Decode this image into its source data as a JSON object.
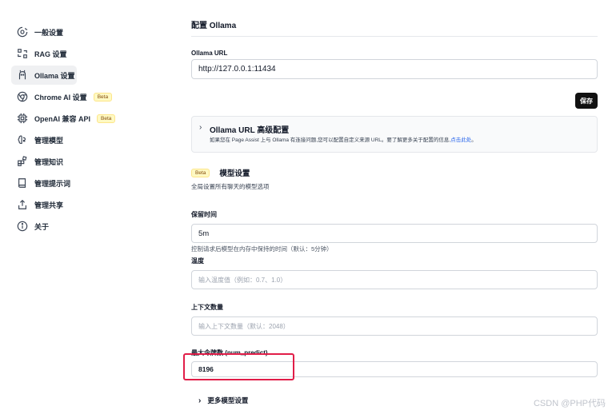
{
  "sidebar": {
    "items": [
      {
        "label": "一般设置",
        "icon": "gear-icon"
      },
      {
        "label": "RAG 设置",
        "icon": "rag-icon"
      },
      {
        "label": "Ollama 设置",
        "icon": "ollama-icon"
      },
      {
        "label": "Chrome AI 设置",
        "icon": "chrome-icon",
        "badge": "Beta"
      },
      {
        "label": "OpenAI 兼容 API",
        "icon": "chip-icon",
        "badge": "Beta"
      },
      {
        "label": "管理模型",
        "icon": "brain-icon"
      },
      {
        "label": "管理知识",
        "icon": "blocks-icon"
      },
      {
        "label": "管理提示词",
        "icon": "book-icon"
      },
      {
        "label": "管理共享",
        "icon": "share-icon"
      },
      {
        "label": "关于",
        "icon": "info-icon"
      }
    ]
  },
  "main": {
    "section_title": "配置 Ollama",
    "ollama_url_label": "Ollama URL",
    "ollama_url_value": "http://127.0.0.1:11434",
    "save_label": "保存",
    "advanced": {
      "title": "Ollama URL 高级配置",
      "description": "如果您在 Page Assist 上与 Ollama 有连接问题,您可以配置自定义来源 URL。要了解更多关于配置的信息,",
      "link": "点击此处",
      "end": "。"
    },
    "model_settings": {
      "badge": "Beta",
      "title": "模型设置",
      "subtitle": "全局设置所有聊天的模型选项"
    },
    "keep_alive_label": "保留时间",
    "keep_alive_value": "5m",
    "keep_alive_help": "控制请求后模型在内存中保持的时间（默认：5分钟）",
    "temperature_label": "温度",
    "temperature_placeholder": "输入温度值（例如：0.7、1.0）",
    "context_label": "上下文数量",
    "context_placeholder": "输入上下文数量（默认：2048）",
    "max_tokens_label": "最大令牌数 (num_predict)",
    "max_tokens_value": "8196",
    "more_label": "更多模型设置"
  },
  "watermark": "CSDN @PHP代码"
}
